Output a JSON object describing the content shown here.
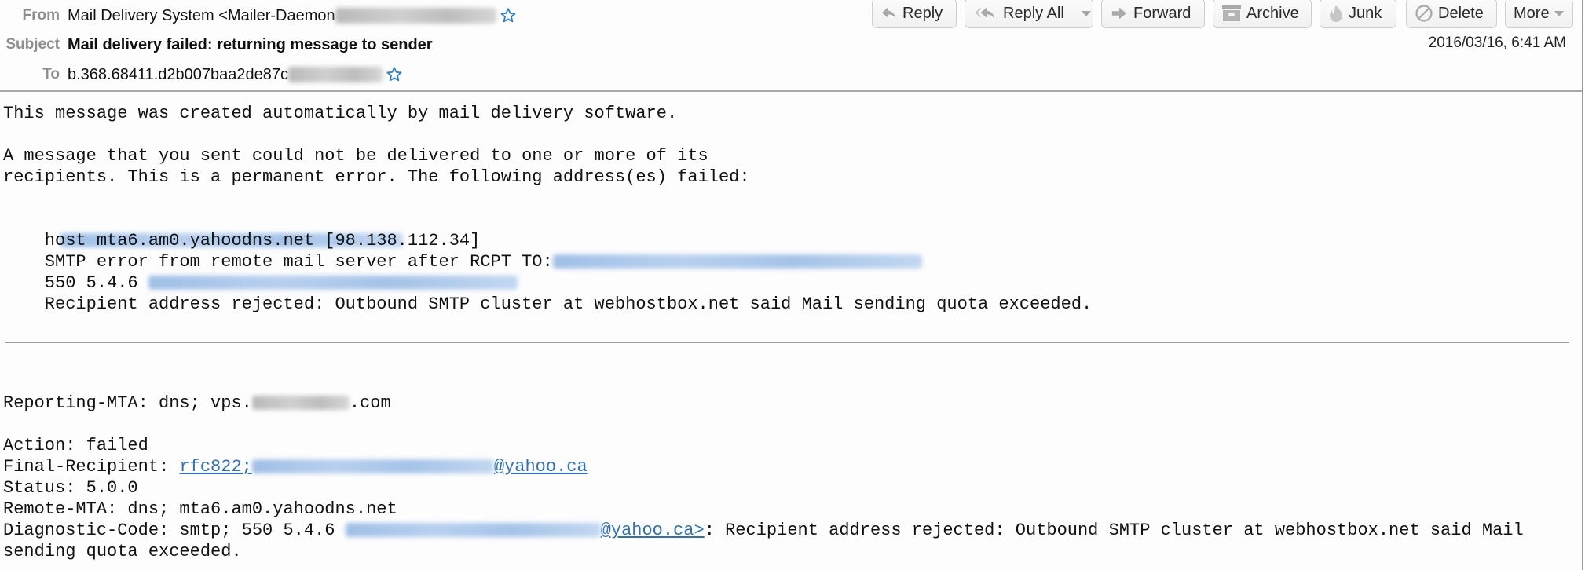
{
  "header": {
    "from_label": "From",
    "from_value": "Mail Delivery System <Mailer-Daemon",
    "subject_label": "Subject",
    "subject_value": "Mail delivery failed: returning message to sender",
    "to_label": "To",
    "to_value": "b.368.68411.d2b007baa2de87c",
    "date": "2016/03/16, 6:41 AM"
  },
  "toolbar": {
    "buttons": [
      {
        "label": "Reply",
        "icon": "reply-icon"
      },
      {
        "label": "Reply All",
        "icon": "reply-all-icon"
      },
      {
        "label": "Forward",
        "icon": "forward-icon"
      },
      {
        "label": "Archive",
        "icon": "archive-icon"
      },
      {
        "label": "Junk",
        "icon": "junk-icon"
      },
      {
        "label": "Delete",
        "icon": "delete-icon"
      },
      {
        "label": "More",
        "icon": "caret-down-icon"
      }
    ]
  },
  "colors": {
    "link": "#2c6fc4",
    "label": "#8e8e8e",
    "star": "#2f7fd6"
  },
  "body": {
    "intro": "This message was created automatically by mail delivery software.",
    "para_line1": "A message that you sent could not be delivered to one or more of its",
    "para_line2": "recipients. This is a permanent error. The following address(es) failed:",
    "host_line": "    host mta6.am0.yahoodns.net [98.138.112.34]",
    "smtp_line": "    SMTP error from remote mail server after RCPT TO:",
    "code_line": "    550 5.4.6 ",
    "reject_line": "    Recipient address rejected: Outbound SMTP cluster at webhostbox.net said Mail sending quota exceeded.",
    "reporting_mta_prefix": "Reporting-MTA: dns; vps.",
    "reporting_mta_suffix": ".com",
    "action": "Action: failed",
    "final_recipient_label": "Final-Recipient: ",
    "final_recipient_link_prefix": "rfc822;",
    "final_recipient_link_suffix": "@yahoo.ca",
    "status": "Status: 5.0.0",
    "remote_mta": "Remote-MTA: dns; mta6.am0.yahoodns.net",
    "diagnostic_prefix": "Diagnostic-Code: smtp; 550 5.4.6 ",
    "diagnostic_link_suffix": "@yahoo.ca>",
    "diagnostic_rest": ": Recipient address rejected: Outbound SMTP cluster at webhostbox.net said Mail",
    "diagnostic_line2": "sending quota exceeded."
  }
}
